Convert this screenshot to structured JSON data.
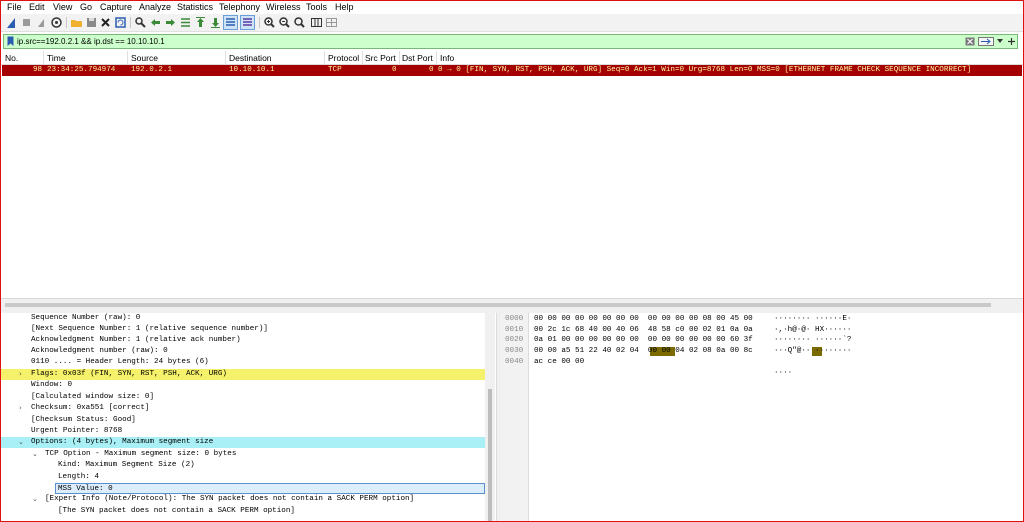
{
  "menu": [
    "File",
    "Edit",
    "View",
    "Go",
    "Capture",
    "Analyze",
    "Statistics",
    "Telephony",
    "Wireless",
    "Tools",
    "Help"
  ],
  "filter": {
    "value": "ip.src==192.0.2.1 &&  ip.dst == 10.10.10.1"
  },
  "packet_list": {
    "columns": [
      "No.",
      "Time",
      "Source",
      "Destination",
      "Protocol",
      "Src Port",
      "Dst Port",
      "Info"
    ],
    "rows": [
      {
        "no": "98",
        "time": "23:34:25.794974",
        "source": "192.0.2.1",
        "destination": "10.10.10.1",
        "protocol": "TCP",
        "src_port": "0",
        "dst_port": "0",
        "info": "0 → 0 [FIN, SYN, RST, PSH, ACK, URG] Seq=0 Ack=1 Win=0 Urg=8768 Len=0 MSS=0 [ETHERNET FRAME CHECK SEQUENCE INCORRECT]"
      }
    ],
    "row_colors": {
      "bg": "#a40000",
      "fg": "#fff8a0"
    }
  },
  "details": [
    {
      "text": "Sequence Number (raw): 0"
    },
    {
      "text": "[Next Sequence Number: 1    (relative sequence number)]"
    },
    {
      "text": "Acknowledgment Number: 1    (relative ack number)"
    },
    {
      "text": "Acknowledgment number (raw): 0"
    },
    {
      "text": "0110 .... = Header Length: 24 bytes (6)"
    },
    {
      "text": "Flags: 0x03f (FIN, SYN, RST, PSH, ACK, URG)"
    },
    {
      "text": "Window: 0"
    },
    {
      "text": "[Calculated window size: 0]"
    },
    {
      "text": "Checksum: 0xa551 [correct]"
    },
    {
      "text": "[Checksum Status: Good]"
    },
    {
      "text": "Urgent Pointer: 8768"
    },
    {
      "text": "Options: (4 bytes), Maximum segment size"
    },
    {
      "text": "TCP Option - Maximum segment size: 0 bytes"
    },
    {
      "text": "Kind: Maximum Segment Size (2)"
    },
    {
      "text": "Length: 4"
    },
    {
      "text": "MSS Value: 0"
    },
    {
      "text": "[Expert Info (Note/Protocol): The SYN packet does not contain a SACK PERM option]"
    },
    {
      "text": "[The SYN packet does not contain a SACK PERM option]"
    }
  ],
  "bytes": [
    {
      "offset": "0000",
      "hex": "00 00 00 00 00 00 00 00  00 00 00 00 08 00 45 00",
      "ascii": "········ ······E·"
    },
    {
      "offset": "0010",
      "hex": "00 2c 1c 68 40 00 40 06  48 58 c0 00 02 01 0a 0a",
      "ascii": "·,·h@·@· HX······"
    },
    {
      "offset": "0020",
      "hex": "0a 01 00 00 00 00 00 00  00 00 00 00 00 00 60 3f",
      "ascii": "········ ······`?"
    },
    {
      "offset": "0030",
      "hex": "00 00 a5 51 22 40 02 04  00 00 04 02 08 0a 00 8c",
      "ascii": "···Q\"@·· ········"
    },
    {
      "offset": "0040",
      "hex": "ac ce 00 00",
      "ascii": "····"
    }
  ],
  "colors": {
    "filter_bg": "#ccffcc",
    "flags_highlight": "#f5f16a",
    "options_highlight": "#a8f0f5",
    "bytes_highlight": "#7a6a00"
  }
}
